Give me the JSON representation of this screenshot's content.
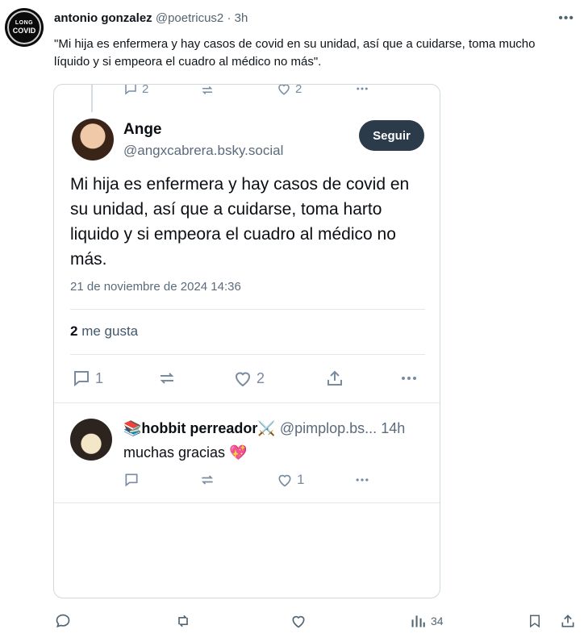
{
  "post": {
    "avatar_text_top": "LONG",
    "avatar_text_main": "COVID",
    "author_name": "antonio gonzalez",
    "author_handle": "@poetricus2",
    "separator": "·",
    "time": "3h",
    "more": "•••",
    "text": "\"Mi hija es enfermera y hay casos de covid en su unidad, así que a cuidarse, toma mucho líquido y si empeora el cuadro al médico no más\"."
  },
  "embed": {
    "previous_actions": {
      "replies": "2",
      "likes": "2"
    },
    "main": {
      "name": "Ange",
      "handle": "@angxcabrera.bsky.social",
      "follow_label": "Seguir",
      "text": "Mi hija es enfermera y hay casos de covid en su unidad, así que a cuidarse, toma harto liquido y si empeora el cuadro al médico no más.",
      "date": "21 de noviembre de 2024 14:36",
      "likes_count": "2",
      "likes_label": "me gusta",
      "actions": {
        "replies": "1",
        "likes": "2"
      }
    },
    "reply": {
      "name": "📚hobbit perreador⚔️",
      "handle": "@pimplop.bs...",
      "time": "14h",
      "text": "muchas gracias 💖",
      "actions": {
        "likes": "1"
      }
    }
  },
  "bottom_bar": {
    "views": "34"
  },
  "colors": {
    "follow_bg": "#2b3b4a",
    "icon": "#788ba0",
    "border": "#cfd9de"
  }
}
